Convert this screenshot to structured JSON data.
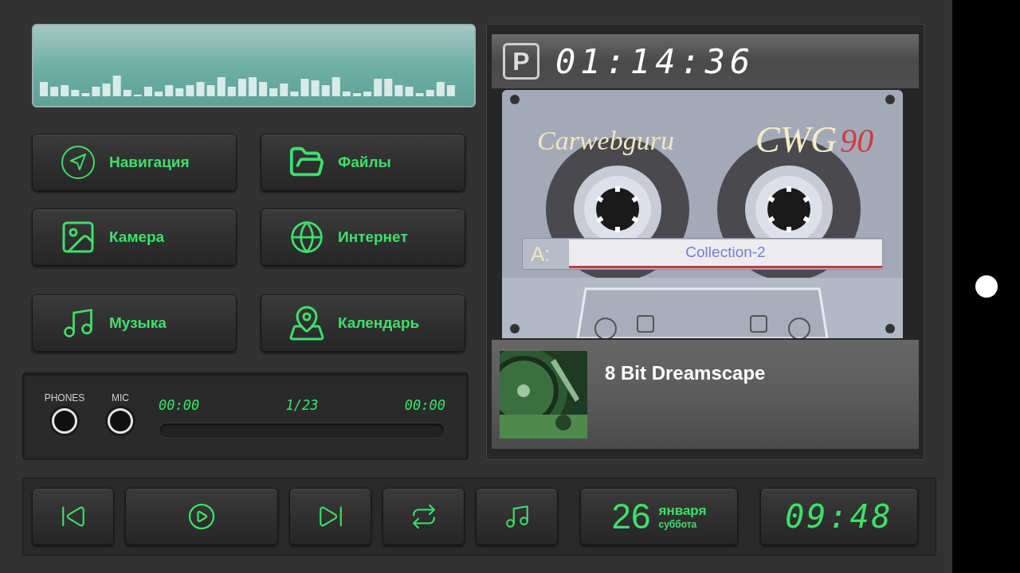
{
  "apps": [
    {
      "label": "Навигация"
    },
    {
      "label": "Файлы"
    },
    {
      "label": "Камера"
    },
    {
      "label": "Интернет"
    },
    {
      "label": "Музыка"
    },
    {
      "label": "Календарь"
    }
  ],
  "audio_panel": {
    "jacks": [
      "PHONES",
      "MIC"
    ],
    "elapsed": "00:00",
    "track_number": "1/23",
    "duration": "00:00"
  },
  "player": {
    "parking_indicator": "P",
    "timer": "01:14:36",
    "cassette": {
      "brand": "Carwebguru",
      "model": "CWG",
      "length": "90",
      "side": "A:",
      "label": "Collection-2"
    },
    "track_title": "8 Bit Dreamscape"
  },
  "controls": [
    {
      "kind": "previous"
    },
    {
      "kind": "play"
    },
    {
      "kind": "next"
    },
    {
      "kind": "repeat"
    },
    {
      "kind": "music"
    }
  ],
  "date": {
    "day": "26",
    "month": "января",
    "weekday": "суббота"
  },
  "clock": "09:48"
}
